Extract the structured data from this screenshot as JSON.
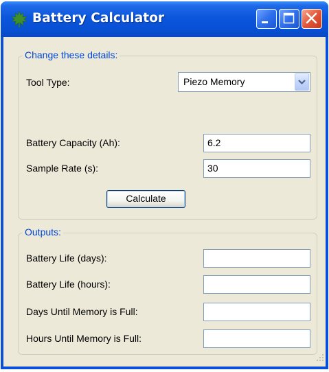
{
  "window": {
    "title": "Battery Calculator",
    "app_icon": "leaf-icon",
    "controls": [
      "minimize-icon",
      "maximize-icon",
      "close-icon"
    ]
  },
  "inputs_group": {
    "legend": "Change these details:",
    "tool_type_label": "Tool Type:",
    "tool_type_value": "Piezo Memory",
    "battery_capacity_label": "Battery Capacity (Ah):",
    "battery_capacity_value": "6.2",
    "sample_rate_label": "Sample Rate (s):",
    "sample_rate_value": "30",
    "calculate_label": "Calculate"
  },
  "outputs_group": {
    "legend": "Outputs:",
    "battery_life_days_label": "Battery Life (days):",
    "battery_life_days_value": "",
    "battery_life_hours_label": "Battery Life (hours):",
    "battery_life_hours_value": "",
    "days_until_full_label": "Days Until Memory is Full:",
    "days_until_full_value": "",
    "hours_until_full_label": "Hours Until Memory is Full:",
    "hours_until_full_value": ""
  },
  "colors": {
    "titlebar": "#0a56dc",
    "window_bg": "#ece9d8",
    "group_legend": "#0046d5",
    "close_button": "#e2583a"
  }
}
